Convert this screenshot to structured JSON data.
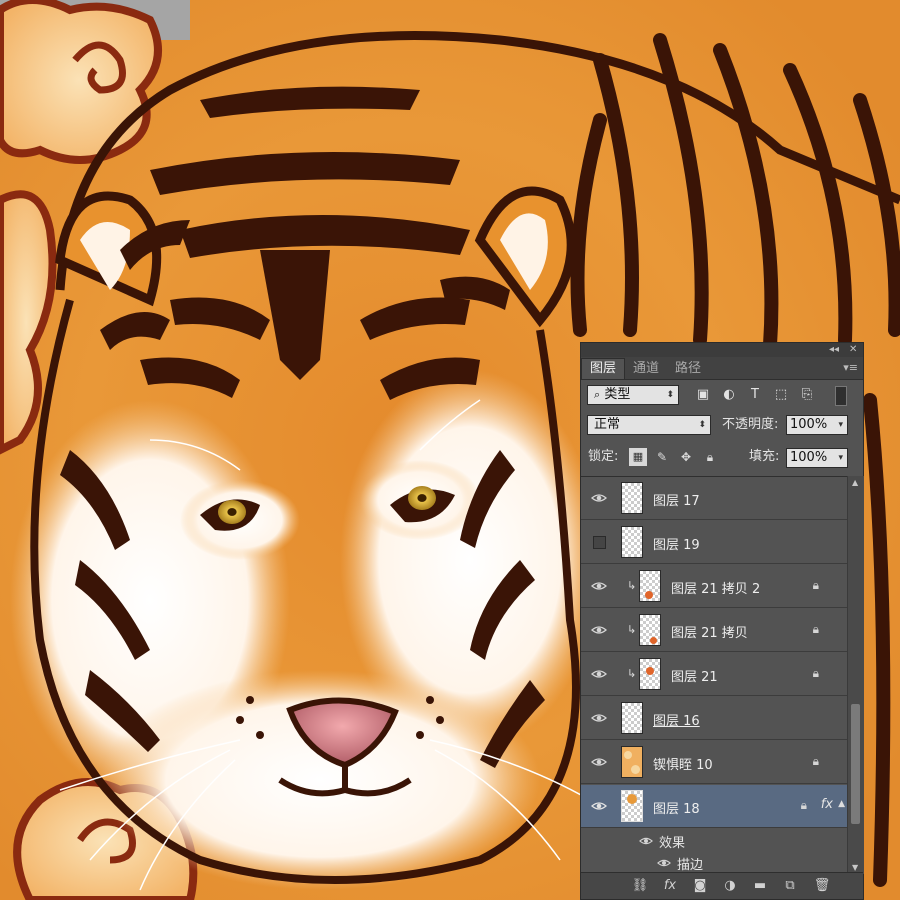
{
  "panel": {
    "tabs": [
      "图层",
      "通道",
      "路径"
    ],
    "filter": {
      "label": "类型"
    },
    "blend_mode": "正常",
    "opacity_label": "不透明度:",
    "opacity_value": "100%",
    "lock_label": "锁定:",
    "fill_label": "填充:",
    "fill_value": "100%",
    "layers": [
      {
        "name": "图层 17",
        "visible": true,
        "clipped": false,
        "locked": false
      },
      {
        "name": "图层 19",
        "visible": false,
        "clipped": false,
        "locked": false
      },
      {
        "name": "图层 21 拷贝 2",
        "visible": true,
        "clipped": true,
        "locked": true
      },
      {
        "name": "图层 21 拷贝",
        "visible": true,
        "clipped": true,
        "locked": true
      },
      {
        "name": "图层 21",
        "visible": true,
        "clipped": true,
        "locked": true
      },
      {
        "name": "图层 16",
        "visible": true,
        "clipped": false,
        "locked": false
      },
      {
        "name": "锲惧眰 10",
        "visible": true,
        "clipped": false,
        "locked": true
      },
      {
        "name": "图层 18",
        "visible": true,
        "clipped": false,
        "locked": true,
        "selected": true,
        "fx": "fx"
      }
    ],
    "effects_label": "效果",
    "stroke_label": "描边"
  },
  "icons": {
    "search": "search-icon",
    "eye": "eye-icon",
    "lock": "lock-icon",
    "link": "link-icon",
    "fx": "fx-icon",
    "mask": "mask-icon",
    "adjustment": "adjustment-icon",
    "folder": "folder-icon",
    "new_layer": "new-layer-icon",
    "trash": "trash-icon"
  },
  "colors": {
    "panel_bg": "#535353",
    "selected_row": "#596a82",
    "tiger_orange": "#e8922e",
    "stripe_brown": "#3a1406"
  }
}
